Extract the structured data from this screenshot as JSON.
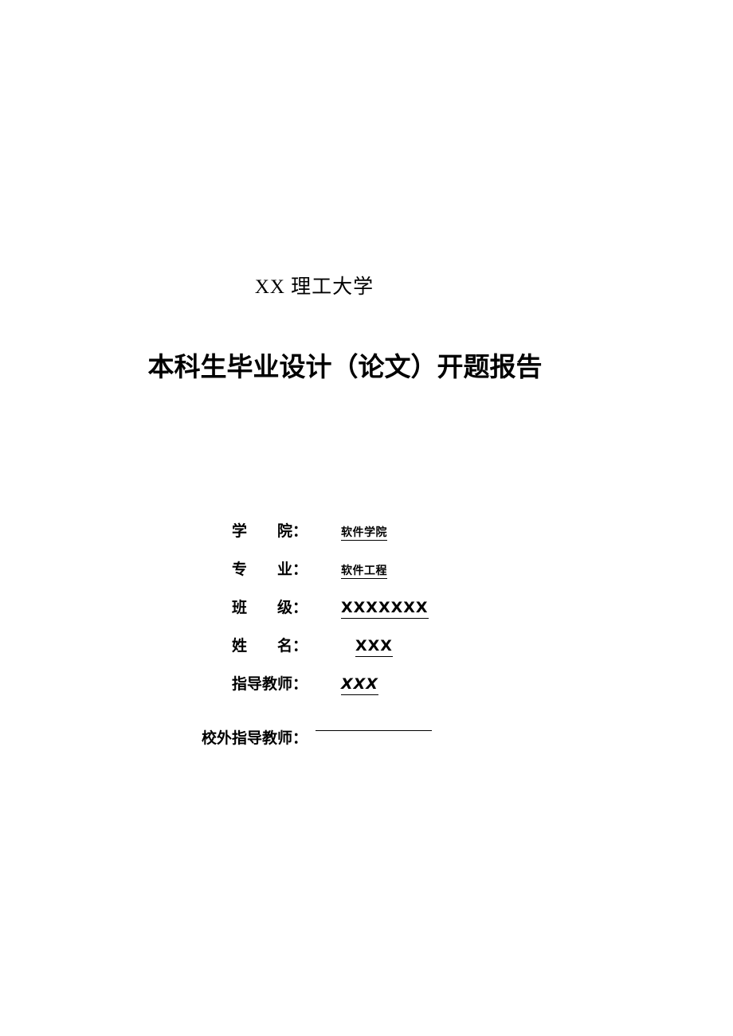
{
  "page": {
    "background_color": "#ffffff",
    "text_color": "#000000"
  },
  "heading": {
    "university": "XX 理工大学",
    "title": "本科生毕业设计（论文）开题报告"
  },
  "form": {
    "rows": [
      {
        "label": "学　　院：",
        "value": "软件学院",
        "style": "cn",
        "blank": false
      },
      {
        "label": "专　　业：",
        "value": "软件工程",
        "style": "cn",
        "blank": false
      },
      {
        "label": "班　　级：",
        "value": "XXXXXXX",
        "style": "latin",
        "blank": false
      },
      {
        "label": "姓　　名：",
        "value": "XXX",
        "style": "latin",
        "blank": false
      },
      {
        "label": "指导教师：",
        "value": "XXX",
        "style": "latin italic",
        "blank": false
      },
      {
        "label": "校外指导教师：",
        "value": "",
        "style": "blank",
        "blank": true
      }
    ]
  }
}
